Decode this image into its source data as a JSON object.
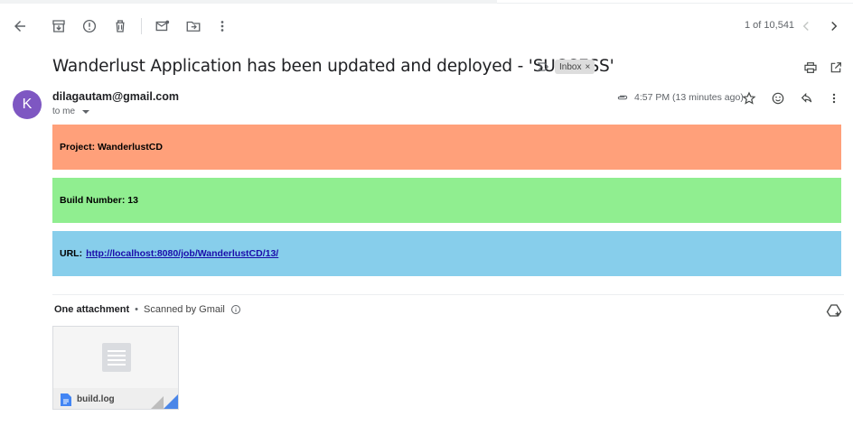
{
  "toolbar": {
    "back_icon": "arrow-left-icon",
    "archive_icon": "archive-icon",
    "spam_icon": "report-spam-icon",
    "delete_icon": "trash-icon",
    "unread_icon": "mark-unread-icon",
    "move_icon": "move-to-folder-icon",
    "more_icon": "more-vertical-icon",
    "pager": "1 of 10,541",
    "prev_icon": "chevron-left-icon",
    "next_icon": "chevron-right-icon"
  },
  "email": {
    "subject": "Wanderlust Application has been updated and deployed - 'SUCCESS'",
    "label": "Inbox",
    "label_close": "×",
    "avatar_letter": "K",
    "avatar_color": "#7e57c2",
    "sender": "dilagautam@gmail.com",
    "recipient": "to me",
    "time": "4:57 PM (13 minutes ago)"
  },
  "body": {
    "project_label": "Project: WanderlustCD",
    "build_label": "Build Number: 13",
    "url_prefix": "URL:",
    "url_link": "http://localhost:8080/job/WanderlustCD/13/",
    "colors": {
      "project_bg": "#ffa07a",
      "build_bg": "#90ee90",
      "url_bg": "#87ceeb"
    }
  },
  "attachments": {
    "title": "One attachment",
    "separator": "•",
    "scanned": "Scanned by Gmail",
    "file_name": "build.log"
  }
}
